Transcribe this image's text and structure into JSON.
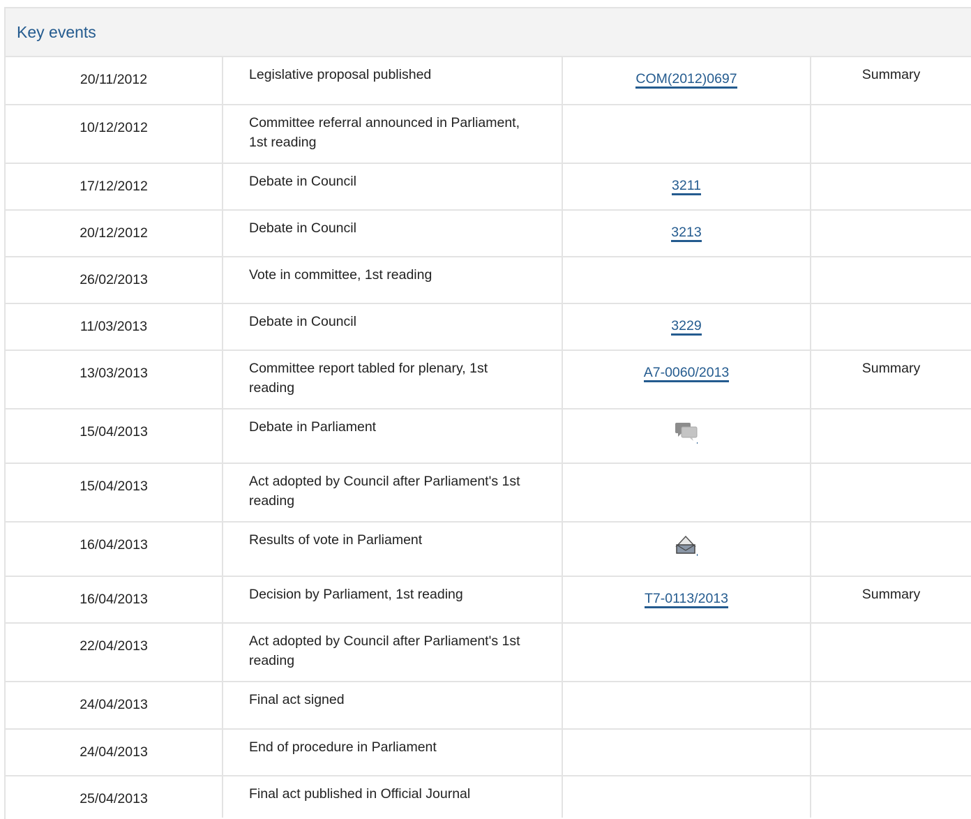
{
  "section": {
    "title": "Key events"
  },
  "rows": [
    {
      "date": "20/11/2012",
      "event": "Legislative proposal published",
      "doc": "COM(2012)0697",
      "summary": "Summary"
    },
    {
      "date": "10/12/2012",
      "event": "Committee referral announced in Parliament, 1st reading",
      "doc": "",
      "summary": ""
    },
    {
      "date": "17/12/2012",
      "event": "Debate in Council",
      "doc": "3211",
      "summary": ""
    },
    {
      "date": "20/12/2012",
      "event": "Debate in Council",
      "doc": "3213",
      "summary": ""
    },
    {
      "date": "26/02/2013",
      "event": "Vote in committee, 1st reading",
      "doc": "",
      "summary": ""
    },
    {
      "date": "11/03/2013",
      "event": "Debate in Council",
      "doc": "3229",
      "summary": ""
    },
    {
      "date": "13/03/2013",
      "event": "Committee report tabled for plenary, 1st reading",
      "doc": "A7-0060/2013",
      "summary": "Summary"
    },
    {
      "date": "15/04/2013",
      "event": "Debate in Parliament",
      "doc": "",
      "icon": "debate-icon",
      "summary": ""
    },
    {
      "date": "15/04/2013",
      "event": "Act adopted by Council after Parliament's 1st reading",
      "doc": "",
      "summary": ""
    },
    {
      "date": "16/04/2013",
      "event": "Results of vote in Parliament",
      "doc": "",
      "icon": "vote-results-icon",
      "summary": ""
    },
    {
      "date": "16/04/2013",
      "event": "Decision by Parliament, 1st reading",
      "doc": "T7-0113/2013",
      "summary": "Summary"
    },
    {
      "date": "22/04/2013",
      "event": "Act adopted by Council after Parliament's 1st reading",
      "doc": "",
      "summary": ""
    },
    {
      "date": "24/04/2013",
      "event": "Final act signed",
      "doc": "",
      "summary": ""
    },
    {
      "date": "24/04/2013",
      "event": "End of procedure in Parliament",
      "doc": "",
      "summary": ""
    },
    {
      "date": "25/04/2013",
      "event": "Final act published in Official Journal",
      "doc": "",
      "summary": ""
    }
  ],
  "colors": {
    "link": "#245b8f",
    "border": "#e3e3e3",
    "header_bg": "#f3f3f3"
  }
}
